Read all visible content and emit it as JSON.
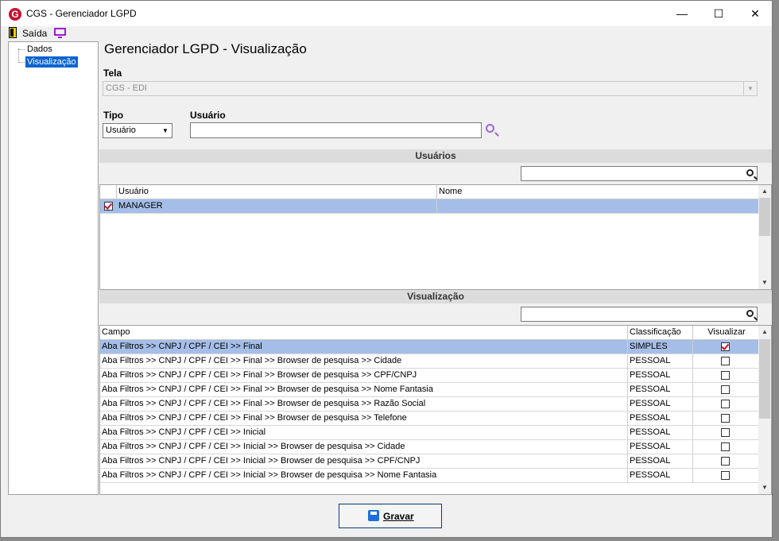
{
  "window": {
    "title": "CGS - Gerenciador LGPD",
    "logo_letter": "G",
    "minimize": "—",
    "maximize": "☐",
    "close": "✕"
  },
  "menu": {
    "exit_label": "Saída"
  },
  "tree": {
    "items": [
      {
        "label": "Dados"
      },
      {
        "label": "Visualização"
      }
    ]
  },
  "page_title": "Gerenciador LGPD - Visualização",
  "tela": {
    "label": "Tela",
    "value": "CGS - EDI",
    "arrow": "▼"
  },
  "tipo": {
    "label": "Tipo",
    "value": "Usuário",
    "arrow": "▼"
  },
  "usuario": {
    "label": "Usuário",
    "value": ""
  },
  "usuarios_section": {
    "title": "Usuários",
    "columns": [
      "Usuário",
      "Nome"
    ],
    "rows": [
      {
        "usuario": "MANAGER",
        "nome": "",
        "checked": true
      }
    ]
  },
  "visualizacao_section": {
    "title": "Visualização",
    "columns": [
      "Campo",
      "Classificação",
      "Visualizar"
    ],
    "rows": [
      {
        "campo": "Aba Filtros >> CNPJ / CPF / CEI >> Final",
        "classificacao": "SIMPLES",
        "visualizar": true
      },
      {
        "campo": "Aba Filtros >> CNPJ / CPF / CEI >> Final >> Browser de pesquisa >> Cidade",
        "classificacao": "PESSOAL",
        "visualizar": false
      },
      {
        "campo": "Aba Filtros >> CNPJ / CPF / CEI >> Final >> Browser de pesquisa >> CPF/CNPJ",
        "classificacao": "PESSOAL",
        "visualizar": false
      },
      {
        "campo": "Aba Filtros >> CNPJ / CPF / CEI >> Final >> Browser de pesquisa >> Nome Fantasia",
        "classificacao": "PESSOAL",
        "visualizar": false
      },
      {
        "campo": "Aba Filtros >> CNPJ / CPF / CEI >> Final >> Browser de pesquisa >> Razão Social",
        "classificacao": "PESSOAL",
        "visualizar": false
      },
      {
        "campo": "Aba Filtros >> CNPJ / CPF / CEI >> Final >> Browser de pesquisa >> Telefone",
        "classificacao": "PESSOAL",
        "visualizar": false
      },
      {
        "campo": "Aba Filtros >> CNPJ / CPF / CEI >> Inicial",
        "classificacao": "PESSOAL",
        "visualizar": false
      },
      {
        "campo": "Aba Filtros >> CNPJ / CPF / CEI >> Inicial >> Browser de pesquisa >> Cidade",
        "classificacao": "PESSOAL",
        "visualizar": false
      },
      {
        "campo": "Aba Filtros >> CNPJ / CPF / CEI >> Inicial >> Browser de pesquisa >> CPF/CNPJ",
        "classificacao": "PESSOAL",
        "visualizar": false
      },
      {
        "campo": "Aba Filtros >> CNPJ / CPF / CEI >> Inicial >> Browser de pesquisa >> Nome Fantasia",
        "classificacao": "PESSOAL",
        "visualizar": false
      }
    ]
  },
  "scroll": {
    "up": "▲",
    "down": "▼"
  },
  "buttons": {
    "gravar": "Gravar"
  },
  "colors": {
    "selection": "#0a64d0",
    "row_highlight": "#a5bee8",
    "check": "#c8102e",
    "accent_purple": "#9b1fd6"
  }
}
